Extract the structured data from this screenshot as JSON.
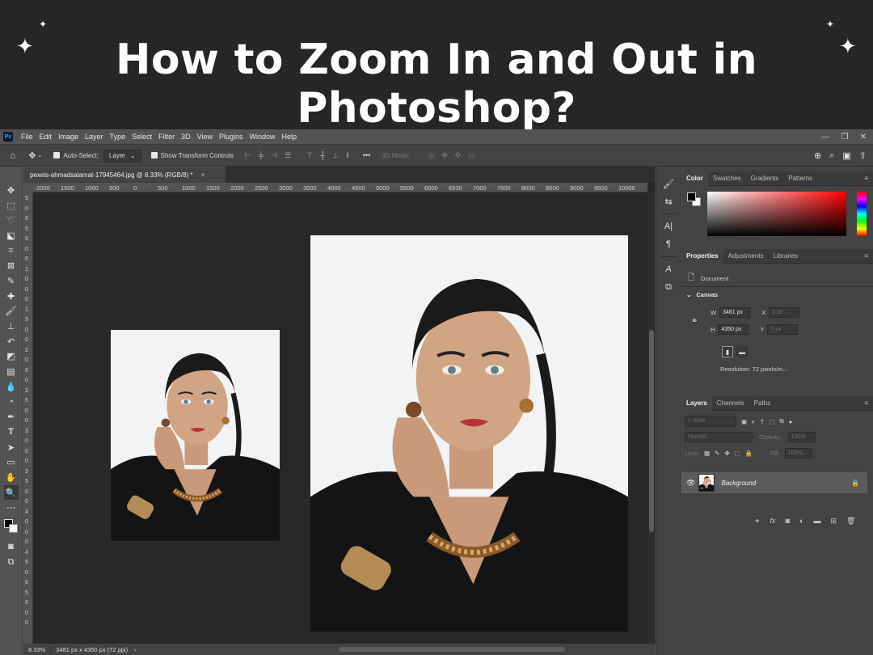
{
  "banner": {
    "headline": "How to Zoom In and Out in Photoshop?"
  },
  "menubar": {
    "logo": "Ps",
    "items": [
      "File",
      "Edit",
      "Image",
      "Layer",
      "Type",
      "Select",
      "Filter",
      "3D",
      "View",
      "Plugins",
      "Window",
      "Help"
    ]
  },
  "options": {
    "auto_select_label": "Auto-Select:",
    "auto_select_value": "Layer",
    "show_transform_label": "Show Transform Controls",
    "mode_3d_label": "3D Mode:"
  },
  "document": {
    "tab_title": "pexels-ahmadsalamat-17945464.jpg @ 8.33% (RGB/8) *",
    "tab_close": "×",
    "ruler_h": [
      "2000",
      "1500",
      "1000",
      "500",
      "0",
      "500",
      "1000",
      "1500",
      "2000",
      "2500",
      "3000",
      "3500",
      "4000",
      "4500",
      "5000",
      "5500",
      "6000",
      "6500",
      "7000",
      "7500",
      "8000",
      "8500",
      "9000",
      "9500",
      "10000"
    ],
    "ruler_v": [
      "5",
      "0",
      "0",
      "5",
      "0",
      "0",
      "0",
      "1",
      "0",
      "0",
      "0",
      "1",
      "5",
      "0",
      "0",
      "2",
      "0",
      "0",
      "0",
      "2",
      "5",
      "0",
      "0",
      "3",
      "0",
      "0",
      "0",
      "3",
      "5",
      "0",
      "0",
      "4",
      "0",
      "0",
      "0",
      "4",
      "5",
      "0",
      "0",
      "5",
      "0",
      "0",
      "0"
    ],
    "status_zoom": "8.33%",
    "status_info": "3481 px x 4350 px (72 ppi)"
  },
  "color_panel": {
    "tabs": [
      "Color",
      "Swatches",
      "Gradients",
      "Patterns"
    ]
  },
  "properties_panel": {
    "tabs": [
      "Properties",
      "Adjustments",
      "Libraries"
    ],
    "document_label": "Document",
    "section": "Canvas",
    "w_label": "W",
    "w_value": "3481 px",
    "h_label": "H",
    "h_value": "4350 px",
    "x_label": "X",
    "x_value": "0 px",
    "y_label": "Y",
    "y_value": "0 px",
    "resolution": "Resolution: 72 pixels/in..."
  },
  "layers_panel": {
    "tabs": [
      "Layers",
      "Channels",
      "Paths"
    ],
    "kind_placeholder": "Kind",
    "blend_mode": "Normal",
    "opacity_label": "Opacity:",
    "opacity_value": "100%",
    "lock_label": "Lock:",
    "fill_label": "Fill:",
    "fill_value": "100%",
    "layer_name": "Background"
  },
  "colors": {
    "accent": "#31a8ff",
    "panel": "#434343",
    "canvas": "#282828"
  }
}
